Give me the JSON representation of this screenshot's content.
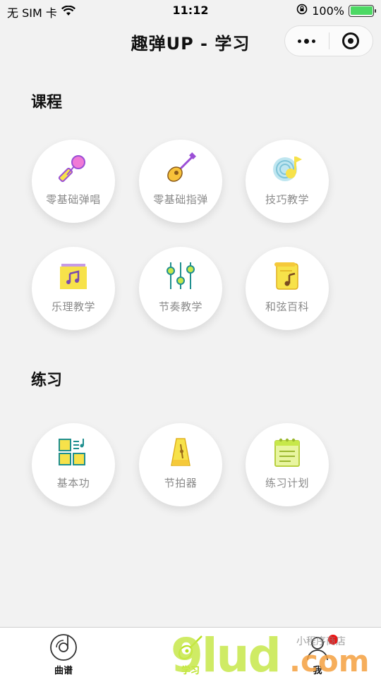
{
  "status_bar": {
    "carrier": "无 SIM 卡",
    "time": "11:12",
    "battery_percent": "100%",
    "battery_level": 1.0
  },
  "nav": {
    "title": "趣弹UP - 学习",
    "more_icon": "more-dots-icon",
    "close_icon": "target-circle-icon"
  },
  "courses": {
    "title": "课程",
    "items": [
      {
        "label": "零基础弹唱",
        "icon": "microphone-icon"
      },
      {
        "label": "零基础指弹",
        "icon": "guitar-icon"
      },
      {
        "label": "技巧教学",
        "icon": "music-note-disc-icon"
      },
      {
        "label": "乐理教学",
        "icon": "music-book-icon"
      },
      {
        "label": "节奏教学",
        "icon": "equalizer-sliders-icon"
      },
      {
        "label": "和弦百科",
        "icon": "music-scroll-icon"
      }
    ]
  },
  "practice": {
    "title": "练习",
    "items": [
      {
        "label": "基本功",
        "icon": "grid-practice-icon"
      },
      {
        "label": "节拍器",
        "icon": "metronome-icon"
      },
      {
        "label": "练习计划",
        "icon": "notepad-icon"
      }
    ]
  },
  "tab_bar": {
    "tabs": [
      {
        "label": "曲谱",
        "icon": "record-disc-icon",
        "active": false
      },
      {
        "label": "学习",
        "icon": "guitar-icon",
        "active": true
      },
      {
        "label": "我",
        "icon": "user-icon",
        "active": false
      }
    ]
  },
  "colors": {
    "accent_green": "#b8e020",
    "icon_yellow": "#f7e24a",
    "icon_teal": "#1f8f8f",
    "icon_purple": "#9b4fd6",
    "badge_red": "#ee1111",
    "background": "#f2f2f2"
  },
  "watermark": {
    "text": "9lud.com",
    "sub_text": "小程序商店"
  }
}
